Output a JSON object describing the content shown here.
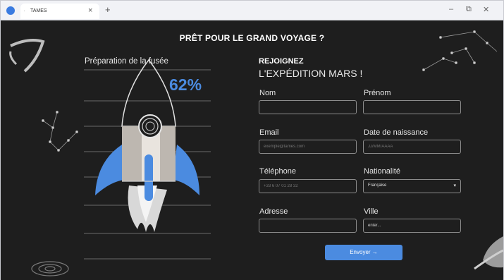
{
  "window": {
    "tab_title": "TAMES",
    "tab_sep": "·",
    "close_glyph": "×",
    "newtab_glyph": "+",
    "minimize_glyph": "–",
    "maximize_glyph": "⧉",
    "close_window_glyph": "✕"
  },
  "heading": "PRÊT POUR LE GRAND VOYAGE ?",
  "progress": {
    "label": "Préparation de la fusée",
    "percent_text": "62%",
    "value": 0.62
  },
  "form": {
    "title_line1": "REJOIGNEZ",
    "title_line2": "L'EXPÉDITION MARS !",
    "fields": {
      "nom": {
        "label": "Nom",
        "placeholder": ""
      },
      "prenom": {
        "label": "Prénom",
        "placeholder": ""
      },
      "email": {
        "label": "Email",
        "placeholder": "exemple@tames.com"
      },
      "naissance": {
        "label": "Date de naissance",
        "placeholder": "JJ/MM/AAAA"
      },
      "telephone": {
        "label": "Téléphone",
        "placeholder": "+33 6 07 01 28 32"
      },
      "nationalite": {
        "label": "Nationalité",
        "selected": "Française"
      },
      "adresse": {
        "label": "Adresse",
        "placeholder": ""
      },
      "ville": {
        "label": "Ville",
        "value": "enter..."
      }
    },
    "submit_label": "Envoyer →"
  },
  "colors": {
    "accent": "#4b8be0",
    "background": "#1e1e1e"
  },
  "icons": {
    "app": "circle-logo-icon",
    "select_caret": "▾"
  }
}
